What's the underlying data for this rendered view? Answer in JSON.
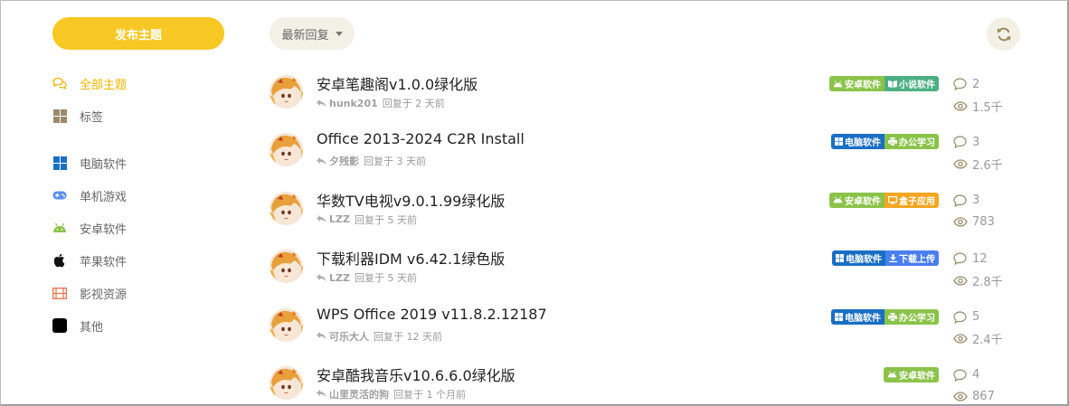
{
  "sidebar": {
    "publish_label": "发布主题",
    "items": [
      {
        "label": "全部主题",
        "icon": "chat-bubbles-icon",
        "color": "#f0b400",
        "active": true
      },
      {
        "label": "标签",
        "icon": "grid-icon",
        "color": "#9a8a6a"
      },
      {
        "label": "电脑软件",
        "icon": "windows-icon",
        "color": "#1a6fc4"
      },
      {
        "label": "单机游戏",
        "icon": "gamepad-icon",
        "color": "#5b8def"
      },
      {
        "label": "安卓软件",
        "icon": "android-icon",
        "color": "#8bc34a"
      },
      {
        "label": "苹果软件",
        "icon": "apple-icon",
        "color": "#111111"
      },
      {
        "label": "影视资源",
        "icon": "film-icon",
        "color": "#e8734a"
      },
      {
        "label": "其他",
        "icon": "square-icon",
        "color": "#000000"
      }
    ]
  },
  "toolbar": {
    "sort_label": "最新回复",
    "refresh_icon": "refresh-icon"
  },
  "topics": [
    {
      "title": "安卓笔趣阁v1.0.0绿化版",
      "user": "hunk201",
      "replied": "回复于 2 天前",
      "replies": "2",
      "views": "1.5千",
      "tags": [
        {
          "label": "安卓软件",
          "color": "#8bc34a",
          "icon": "android-icon"
        },
        {
          "label": "小说软件",
          "color": "#4caf83",
          "icon": "book-icon"
        }
      ]
    },
    {
      "title": "Office 2013-2024 C2R Install",
      "user": "夕残影",
      "replied": "回复于 3 天前",
      "replies": "3",
      "views": "2.6千",
      "tags": [
        {
          "label": "电脑软件",
          "color": "#1a6fc4",
          "icon": "windows-icon"
        },
        {
          "label": "办公学习",
          "color": "#8bc34a",
          "icon": "printer-icon"
        }
      ]
    },
    {
      "title": "华数TV电视v9.0.1.99绿化版",
      "user": "LZZ",
      "replied": "回复于 5 天前",
      "replies": "3",
      "views": "783",
      "tags": [
        {
          "label": "安卓软件",
          "color": "#8bc34a",
          "icon": "android-icon"
        },
        {
          "label": "盒子应用",
          "color": "#f5a623",
          "icon": "tv-icon"
        }
      ]
    },
    {
      "title": "下载利器IDM v6.42.1绿色版",
      "user": "LZZ",
      "replied": "回复于 5 天前",
      "replies": "12",
      "views": "2.8千",
      "tags": [
        {
          "label": "电脑软件",
          "color": "#1a6fc4",
          "icon": "windows-icon"
        },
        {
          "label": "下载上传",
          "color": "#4a7ff0",
          "icon": "download-icon"
        }
      ]
    },
    {
      "title": "WPS Office 2019 v11.8.2.12187",
      "user": "可乐大人",
      "replied": "回复于 12 天前",
      "replies": "5",
      "views": "2.4千",
      "tags": [
        {
          "label": "电脑软件",
          "color": "#1a6fc4",
          "icon": "windows-icon"
        },
        {
          "label": "办公学习",
          "color": "#8bc34a",
          "icon": "printer-icon"
        }
      ]
    },
    {
      "title": "安卓酷我音乐v10.6.6.0绿化版",
      "user": "山里灵活的狗",
      "replied": "回复于 1 个月前",
      "replies": "4",
      "views": "867",
      "tags": [
        {
          "label": "安卓软件",
          "color": "#8bc34a",
          "icon": "android-icon"
        }
      ]
    }
  ]
}
